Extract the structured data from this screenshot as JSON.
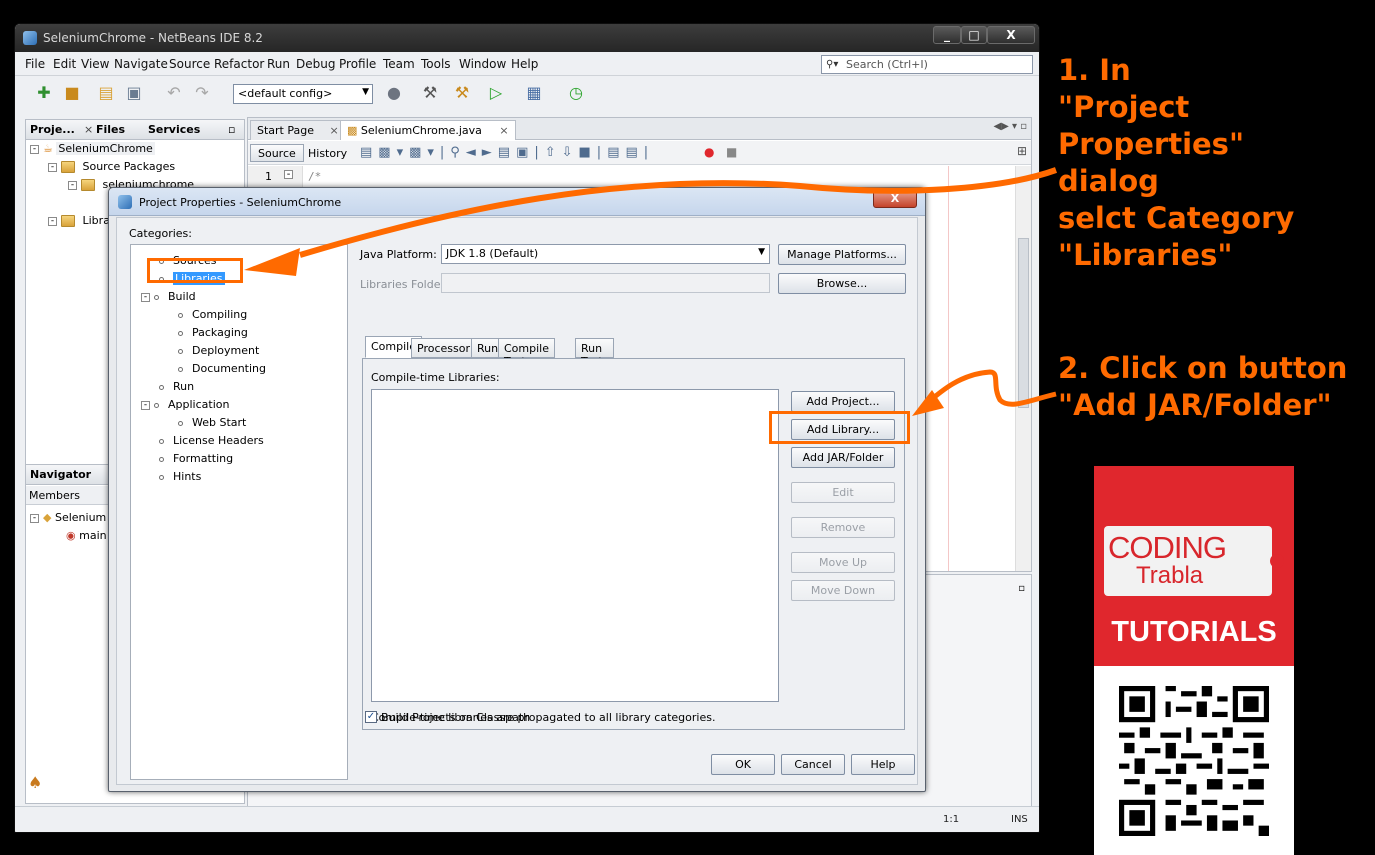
{
  "window": {
    "title": "SeleniumChrome - NetBeans IDE 8.2"
  },
  "menu": [
    "File",
    "Edit",
    "View",
    "Navigate",
    "Source",
    "Refactor",
    "Run",
    "Debug",
    "Profile",
    "Team",
    "Tools",
    "Window",
    "Help"
  ],
  "search": {
    "placeholder": "Search (Ctrl+I)"
  },
  "toolbar": {
    "config": "<default config>"
  },
  "projects_panel": {
    "tabs": [
      "Proje...",
      "Files",
      "Services"
    ],
    "tree": [
      "SeleniumChrome",
      "Source Packages",
      "seleniumchrome",
      "Libra"
    ]
  },
  "navigator_panel": {
    "title": "Navigator",
    "members": "Members",
    "tree": [
      "Selenium",
      "main"
    ]
  },
  "editor": {
    "tabs": [
      "Start Page",
      "SeleniumChrome.java"
    ],
    "source_btn": "Source",
    "history_btn": "History",
    "line_number": "1",
    "first_line": "/*"
  },
  "statusbar": {
    "position": "1:1",
    "mode": "INS"
  },
  "dialog": {
    "title": "Project Properties - SeleniumChrome",
    "close": "X",
    "categories_label": "Categories:",
    "categories": [
      "Sources",
      "Libraries",
      "Build",
      "Compiling",
      "Packaging",
      "Deployment",
      "Documenting",
      "Run",
      "Application",
      "Web Start",
      "License Headers",
      "Formatting",
      "Hints"
    ],
    "java_platform_label": "Java Platform:",
    "java_platform_value": "JDK 1.8 (Default)",
    "manage_platforms": "Manage Platforms...",
    "libraries_folder_label": "Libraries Folder:",
    "browse": "Browse...",
    "tabs": [
      "Compile",
      "Processor",
      "Run",
      "Compile Tests",
      "Run Tests"
    ],
    "compile_time_label": "Compile-time Libraries:",
    "buttons": {
      "add_project": "Add Project...",
      "add_library": "Add Library...",
      "add_jar": "Add JAR/Folder",
      "edit": "Edit",
      "remove": "Remove",
      "move_up": "Move Up",
      "move_down": "Move Down"
    },
    "propagate_note": "Compile-time libraries are propagated to all library categories.",
    "build_on_classpath": "Build Projects on Classpath",
    "ok": "OK",
    "cancel": "Cancel",
    "help": "Help"
  },
  "annotations": {
    "step1": "1. In\n\"Project\nProperties\"\ndialog\nselct Category\n\"Libraries\"",
    "step2": "2. Click on button\n\"Add JAR/Folder\"",
    "accent_color": "#ff6a00"
  },
  "logo": {
    "coding": "CODING",
    "trabla": "Trabla",
    "tutorials": "TUTORIALS"
  }
}
